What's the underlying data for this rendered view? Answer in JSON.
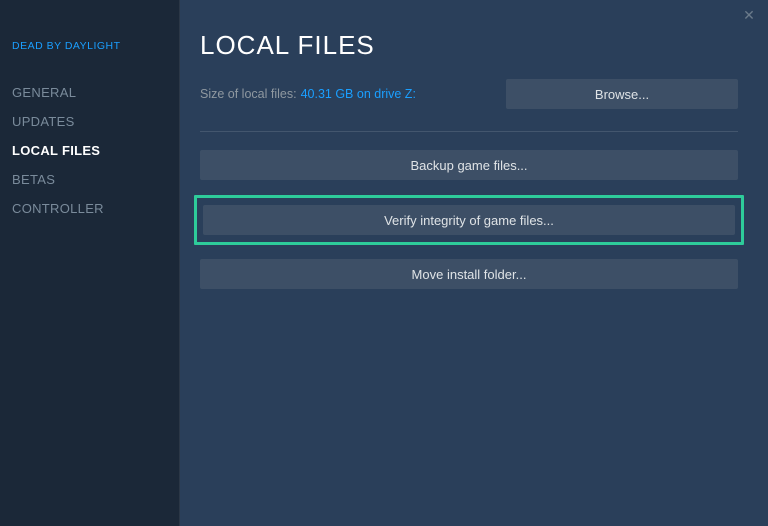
{
  "game_title": "DEAD BY DAYLIGHT",
  "nav": {
    "items": [
      {
        "label": "GENERAL",
        "active": false
      },
      {
        "label": "UPDATES",
        "active": false
      },
      {
        "label": "LOCAL FILES",
        "active": true
      },
      {
        "label": "BETAS",
        "active": false
      },
      {
        "label": "CONTROLLER",
        "active": false
      }
    ]
  },
  "main": {
    "title": "LOCAL FILES",
    "size_label": "Size of local files:",
    "size_value": "40.31 GB on drive Z:",
    "browse_label": "Browse...",
    "backup_label": "Backup game files...",
    "verify_label": "Verify integrity of game files...",
    "move_label": "Move install folder..."
  },
  "close_glyph": "✕"
}
